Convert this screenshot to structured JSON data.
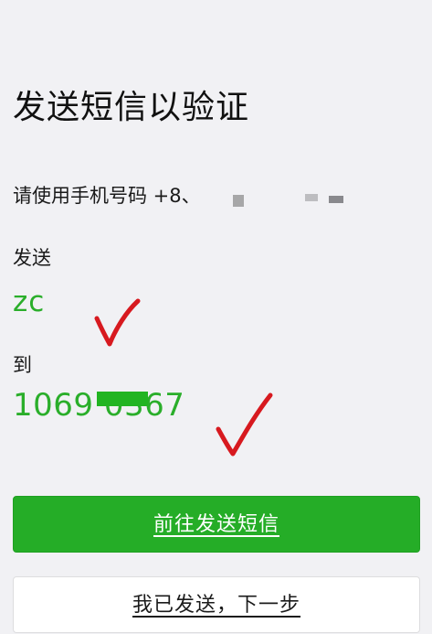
{
  "header": {
    "title": "发送短信以验证"
  },
  "instructions": {
    "phone_line": "请使用手机号码 +8、"
  },
  "message": {
    "send_label": "发送",
    "content": "zc",
    "to_label": "到",
    "number": "1069     0367"
  },
  "actions": {
    "primary_label": "前往发送短信",
    "secondary_label": "我已发送，下一步"
  },
  "colors": {
    "accent_green": "#25ad27",
    "annotation_red": "#d7191f",
    "background": "#f1f1f4"
  }
}
